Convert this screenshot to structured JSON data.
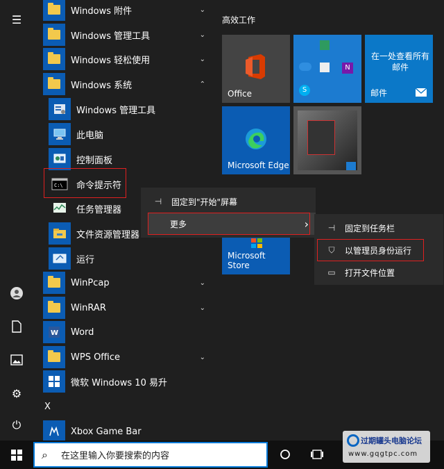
{
  "app_list": {
    "items": [
      {
        "label": "Windows 附件",
        "type": "folder",
        "chevron": "⌄"
      },
      {
        "label": "Windows 管理工具",
        "type": "folder",
        "chevron": "⌄"
      },
      {
        "label": "Windows 轻松使用",
        "type": "folder",
        "chevron": "⌄"
      },
      {
        "label": "Windows 系统",
        "type": "folder",
        "chevron": "⌃"
      },
      {
        "label": "Windows 管理工具",
        "type": "sub"
      },
      {
        "label": "此电脑",
        "type": "sub"
      },
      {
        "label": "控制面板",
        "type": "sub"
      },
      {
        "label": "命令提示符",
        "type": "sub"
      },
      {
        "label": "任务管理器",
        "type": "sub"
      },
      {
        "label": "文件资源管理器",
        "type": "sub"
      },
      {
        "label": "运行",
        "type": "sub"
      },
      {
        "label": "WinPcap",
        "type": "folder",
        "chevron": "⌄"
      },
      {
        "label": "WinRAR",
        "type": "folder",
        "chevron": "⌄"
      },
      {
        "label": "Word",
        "type": "app"
      },
      {
        "label": "WPS Office",
        "type": "folder",
        "chevron": "⌄"
      },
      {
        "label": "微软 Windows 10 易升",
        "type": "app"
      }
    ],
    "letter_x": "X",
    "xbox": "Xbox Game Bar"
  },
  "tiles": {
    "group_title": "高效工作",
    "office": "Office",
    "mail_line1": "在一处查看所有",
    "mail_line2": "邮件",
    "mail_label": "邮件",
    "edge": "Microsoft Edge",
    "store": "Microsoft Store"
  },
  "context_menu": {
    "pin_start": "固定到\"开始\"屏幕",
    "more": "更多",
    "more_arrow": "›"
  },
  "submenu": {
    "pin_taskbar": "固定到任务栏",
    "run_admin": "以管理员身份运行",
    "open_location": "打开文件位置"
  },
  "taskbar": {
    "search_placeholder": "在这里输入你要搜索的内容"
  },
  "watermark": {
    "line1": "过期罐头电脑论坛",
    "line2": "www.gqgtpc.com"
  },
  "colors": {
    "accent": "#0078d7",
    "tile_blue": "#0b5cb3",
    "highlight_box": "#e02020"
  }
}
